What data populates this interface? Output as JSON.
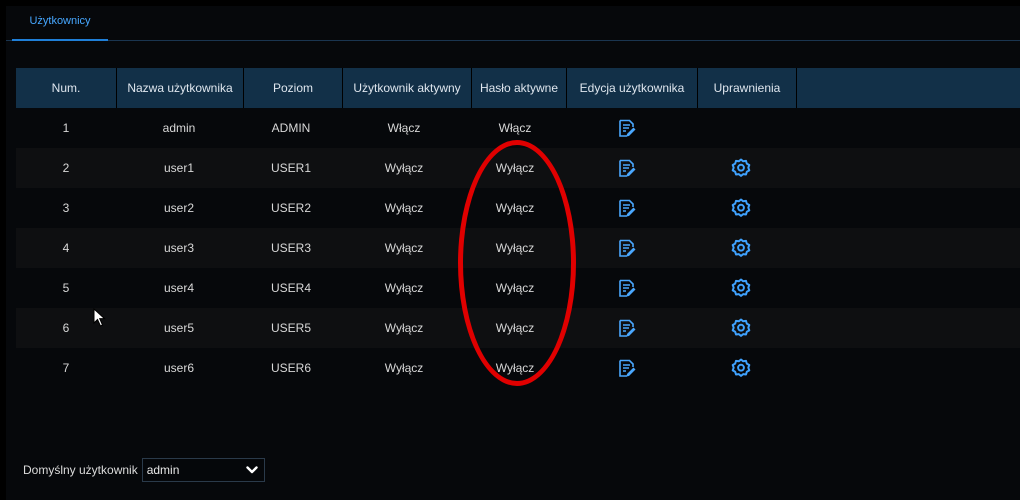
{
  "tabs": [
    {
      "label": "Użytkownicy",
      "active": true
    }
  ],
  "table": {
    "headers": [
      "Num.",
      "Nazwa użytkownika",
      "Poziom",
      "Użytkownik aktywny",
      "Hasło aktywne",
      "Edycja użytkownika",
      "Uprawnienia"
    ],
    "rows": [
      {
        "num": "1",
        "name": "admin",
        "level": "ADMIN",
        "user_active": "Włącz",
        "pass_active": "Włącz",
        "has_edit": true,
        "has_permissions": false
      },
      {
        "num": "2",
        "name": "user1",
        "level": "USER1",
        "user_active": "Wyłącz",
        "pass_active": "Wyłącz",
        "has_edit": true,
        "has_permissions": true
      },
      {
        "num": "3",
        "name": "user2",
        "level": "USER2",
        "user_active": "Wyłącz",
        "pass_active": "Wyłącz",
        "has_edit": true,
        "has_permissions": true
      },
      {
        "num": "4",
        "name": "user3",
        "level": "USER3",
        "user_active": "Wyłącz",
        "pass_active": "Wyłącz",
        "has_edit": true,
        "has_permissions": true
      },
      {
        "num": "5",
        "name": "user4",
        "level": "USER4",
        "user_active": "Wyłącz",
        "pass_active": "Wyłącz",
        "has_edit": true,
        "has_permissions": true
      },
      {
        "num": "6",
        "name": "user5",
        "level": "USER5",
        "user_active": "Wyłącz",
        "pass_active": "Wyłącz",
        "has_edit": true,
        "has_permissions": true
      },
      {
        "num": "7",
        "name": "user6",
        "level": "USER6",
        "user_active": "Wyłącz",
        "pass_active": "Wyłącz",
        "has_edit": true,
        "has_permissions": true
      }
    ]
  },
  "icons": {
    "edit": "edit-icon",
    "permissions": "gear-icon",
    "dropdown": "chevron-down-icon",
    "pointer": "mouse-cursor-icon"
  },
  "default_user": {
    "label": "Domyślny użytkownik",
    "value": "admin"
  },
  "colors": {
    "accent": "#46a7ff",
    "header_bg": "#123048",
    "annotation": "#e00000"
  }
}
